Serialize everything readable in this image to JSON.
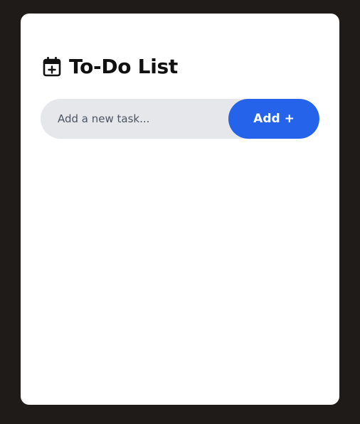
{
  "app": {
    "title": "To-Do List",
    "icon": "calendar-plus-icon"
  },
  "input": {
    "placeholder": "Add a new task...",
    "value": ""
  },
  "add_button": {
    "label": "Add +"
  },
  "colors": {
    "background": "#1f1b18",
    "card": "#ffffff",
    "input_bg": "#e5e7eb",
    "accent": "#2563eb"
  },
  "tasks": []
}
